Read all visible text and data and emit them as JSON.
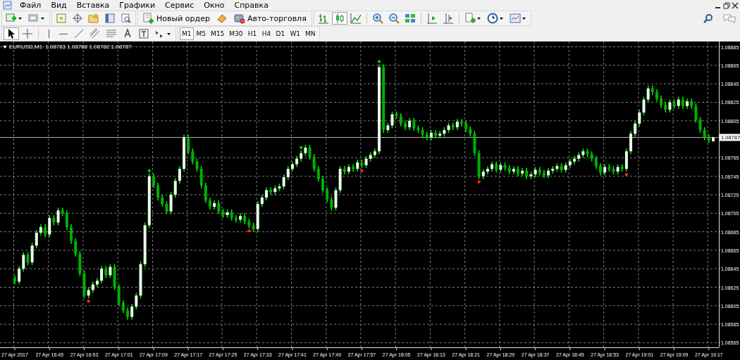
{
  "menu_bar": {
    "items": [
      "Файл",
      "Вид",
      "Вставка",
      "Графики",
      "Сервис",
      "Окно",
      "Справка"
    ]
  },
  "toolbar": {
    "new_order": "Новый ордер",
    "auto_trading": "Авто-торговля",
    "chart_types": [
      {
        "selected": false
      },
      {
        "selected": true
      },
      {
        "selected": false
      }
    ]
  },
  "drawing_toolbar": {
    "tools": [
      {
        "selected": true
      },
      {
        "selected": false
      },
      {
        "selected": false
      },
      {
        "selected": false
      },
      {
        "selected": false
      },
      {
        "selected": false
      },
      {
        "selected": false
      },
      {
        "selected": false
      },
      {
        "selected": false
      },
      {
        "selected": false
      }
    ],
    "timeframes": [
      {
        "label": "M1",
        "selected": true
      },
      {
        "label": "M5",
        "selected": false
      },
      {
        "label": "M15",
        "selected": false
      },
      {
        "label": "M30",
        "selected": false
      },
      {
        "label": "H1",
        "selected": false
      },
      {
        "label": "H4",
        "selected": false
      },
      {
        "label": "D1",
        "selected": false
      },
      {
        "label": "W1",
        "selected": false
      },
      {
        "label": "MN",
        "selected": false
      }
    ]
  },
  "chart": {
    "quote": "1.08783 1.08788 1.08782 1.08787",
    "signals": [
      {
        "kind": "below",
        "color": "#ff2020"
      },
      {
        "kind": "above",
        "color": "#00c000"
      },
      {
        "kind": "below",
        "color": "#ff2020"
      },
      {
        "kind": "above",
        "color": "#00c000"
      },
      {
        "kind": "below",
        "color": "#ff2020"
      },
      {
        "kind": "above",
        "color": "#00c000"
      },
      {
        "kind": "below",
        "color": "#ff2020"
      },
      {
        "kind": "below",
        "color": "#ff2020"
      }
    ],
    "chart_data": {
      "type": "candlestick",
      "title": "EURUSD,M1",
      "grid": true,
      "ylim": [
        1.0856,
        1.0889
      ],
      "yticks": [
        1.08885,
        1.08865,
        1.08845,
        1.08825,
        1.08805,
        1.08765,
        1.08745,
        1.08725,
        1.08705,
        1.08685,
        1.08665,
        1.08645,
        1.08625,
        1.08605,
        1.08585,
        1.08565
      ],
      "ref_lines": [
        {
          "axis": "y",
          "value": 1.08787,
          "label": "1.08787"
        }
      ],
      "categories": [
        "27 Apr 2017",
        null,
        null,
        null,
        null,
        null,
        null,
        null,
        "27 Apr 16:45",
        null,
        null,
        null,
        null,
        null,
        null,
        null,
        "27 Apr 16:53",
        null,
        null,
        null,
        null,
        null,
        null,
        null,
        "27 Apr 17:01",
        null,
        null,
        null,
        null,
        null,
        null,
        null,
        "27 Apr 17:09",
        null,
        null,
        null,
        null,
        null,
        null,
        null,
        "27 Apr 17:17",
        null,
        null,
        null,
        null,
        null,
        null,
        null,
        "27 Apr 17:25",
        null,
        null,
        null,
        null,
        null,
        null,
        null,
        "27 Apr 17:33",
        null,
        null,
        null,
        null,
        null,
        null,
        null,
        "27 Apr 17:41",
        null,
        null,
        null,
        null,
        null,
        null,
        null,
        "27 Apr 17:49",
        null,
        null,
        null,
        null,
        null,
        null,
        null,
        "27 Apr 17:57",
        null,
        null,
        null,
        null,
        null,
        null,
        null,
        "27 Apr 18:05",
        null,
        null,
        null,
        null,
        null,
        null,
        null,
        "27 Apr 18:13",
        null,
        null,
        null,
        null,
        null,
        null,
        null,
        "27 Apr 18:21",
        null,
        null,
        null,
        null,
        null,
        null,
        null,
        "27 Apr 18:29",
        null,
        null,
        null,
        null,
        null,
        null,
        null,
        "27 Apr 18:37",
        null,
        null,
        null,
        null,
        null,
        null,
        null,
        "27 Apr 18:45",
        null,
        null,
        null,
        null,
        null,
        null,
        null,
        "27 Apr 18:53",
        null,
        null,
        null,
        null,
        null,
        null,
        null,
        "27 Apr 19:01",
        null,
        null,
        null,
        null,
        null,
        null,
        null,
        "27 Apr 19:09",
        null,
        null,
        null,
        null,
        null,
        null,
        null,
        "27 Apr 19:17",
        null
      ],
      "ohlc": [
        [
          1.08635,
          1.08638,
          1.08628,
          1.08631
        ],
        [
          1.08631,
          1.08648,
          1.08628,
          1.08645
        ],
        [
          1.08645,
          1.08663,
          1.08642,
          1.0866
        ],
        [
          1.0866,
          1.08663,
          1.08649,
          1.08652
        ],
        [
          1.08652,
          1.08673,
          1.08649,
          1.0867
        ],
        [
          1.0867,
          1.08687,
          1.08667,
          1.08684
        ],
        [
          1.08684,
          1.08693,
          1.08681,
          1.0869
        ],
        [
          1.0869,
          1.08693,
          1.08679,
          1.08682
        ],
        [
          1.08682,
          1.08703,
          1.08679,
          1.087
        ],
        [
          1.087,
          1.08703,
          1.08692,
          1.08695
        ],
        [
          1.08695,
          1.08711,
          1.08692,
          1.08708
        ],
        [
          1.08708,
          1.08711,
          1.08702,
          1.08705
        ],
        [
          1.08705,
          1.08708,
          1.08687,
          1.0869
        ],
        [
          1.0869,
          1.08693,
          1.08672,
          1.08675
        ],
        [
          1.08675,
          1.08678,
          1.08658,
          1.08661
        ],
        [
          1.08661,
          1.08664,
          1.08637,
          1.0864
        ],
        [
          1.0864,
          1.08643,
          1.08613,
          1.08616
        ],
        [
          1.08616,
          1.08625,
          1.08613,
          1.08622
        ],
        [
          1.08622,
          1.08631,
          1.08619,
          1.08628
        ],
        [
          1.08628,
          1.08635,
          1.08625,
          1.08632
        ],
        [
          1.08632,
          1.08648,
          1.08629,
          1.08645
        ],
        [
          1.08645,
          1.08648,
          1.08635,
          1.08638
        ],
        [
          1.08638,
          1.0865,
          1.08635,
          1.08647
        ],
        [
          1.08647,
          1.0865,
          1.08622,
          1.08625
        ],
        [
          1.08625,
          1.08628,
          1.08605,
          1.08608
        ],
        [
          1.08608,
          1.08611,
          1.08597,
          1.086
        ],
        [
          1.086,
          1.08603,
          1.0859,
          1.08593
        ],
        [
          1.08593,
          1.08607,
          1.0859,
          1.08604
        ],
        [
          1.08604,
          1.08619,
          1.08601,
          1.08616
        ],
        [
          1.08616,
          1.08653,
          1.08613,
          1.0865
        ],
        [
          1.0865,
          1.08695,
          1.08647,
          1.08692
        ],
        [
          1.08692,
          1.08748,
          1.08689,
          1.08745
        ],
        [
          1.08745,
          1.08748,
          1.08732,
          1.08735
        ],
        [
          1.08735,
          1.08738,
          1.08719,
          1.08722
        ],
        [
          1.08722,
          1.08725,
          1.08712,
          1.08715
        ],
        [
          1.08715,
          1.08718,
          1.08704,
          1.08707
        ],
        [
          1.08707,
          1.08728,
          1.08704,
          1.08725
        ],
        [
          1.08725,
          1.08743,
          1.08722,
          1.0874
        ],
        [
          1.0874,
          1.08756,
          1.08737,
          1.08753
        ],
        [
          1.08753,
          1.0879,
          1.0875,
          1.08787
        ],
        [
          1.08787,
          1.0879,
          1.08769,
          1.08772
        ],
        [
          1.08772,
          1.08775,
          1.08758,
          1.08761
        ],
        [
          1.08761,
          1.08764,
          1.0875,
          1.08753
        ],
        [
          1.08753,
          1.08756,
          1.08732,
          1.08735
        ],
        [
          1.08735,
          1.08738,
          1.08716,
          1.08719
        ],
        [
          1.08719,
          1.08722,
          1.08709,
          1.08712
        ],
        [
          1.08712,
          1.08719,
          1.08709,
          1.08716
        ],
        [
          1.08716,
          1.08719,
          1.08704,
          1.08707
        ],
        [
          1.08707,
          1.0871,
          1.087,
          1.08703
        ],
        [
          1.08703,
          1.08709,
          1.087,
          1.08706
        ],
        [
          1.08706,
          1.08709,
          1.08697,
          1.087
        ],
        [
          1.087,
          1.08703,
          1.08695,
          1.08698
        ],
        [
          1.08698,
          1.08705,
          1.08695,
          1.08702
        ],
        [
          1.08702,
          1.08705,
          1.08693,
          1.08696
        ],
        [
          1.08696,
          1.08699,
          1.08689,
          1.08692
        ],
        [
          1.08692,
          1.08695,
          1.08685,
          1.08688
        ],
        [
          1.08688,
          1.08718,
          1.08685,
          1.08715
        ],
        [
          1.08715,
          1.08725,
          1.08712,
          1.08722
        ],
        [
          1.08722,
          1.08733,
          1.08719,
          1.0873
        ],
        [
          1.0873,
          1.08733,
          1.08725,
          1.08728
        ],
        [
          1.08728,
          1.08735,
          1.08725,
          1.08732
        ],
        [
          1.08732,
          1.08737,
          1.08729,
          1.08734
        ],
        [
          1.08734,
          1.08747,
          1.08731,
          1.08744
        ],
        [
          1.08744,
          1.08756,
          1.08741,
          1.08753
        ],
        [
          1.08753,
          1.08761,
          1.0875,
          1.08758
        ],
        [
          1.08758,
          1.08767,
          1.08755,
          1.08764
        ],
        [
          1.08764,
          1.08773,
          1.08761,
          1.0877
        ],
        [
          1.0877,
          1.08779,
          1.08767,
          1.08776
        ],
        [
          1.08776,
          1.08779,
          1.08763,
          1.08766
        ],
        [
          1.08766,
          1.08769,
          1.0875,
          1.08753
        ],
        [
          1.08753,
          1.08756,
          1.08739,
          1.08742
        ],
        [
          1.08742,
          1.08745,
          1.08727,
          1.0873
        ],
        [
          1.0873,
          1.08733,
          1.08717,
          1.0872
        ],
        [
          1.0872,
          1.08723,
          1.08708,
          1.08711
        ],
        [
          1.08711,
          1.08733,
          1.08708,
          1.0873
        ],
        [
          1.0873,
          1.08756,
          1.08727,
          1.08753
        ],
        [
          1.08753,
          1.08756,
          1.08747,
          1.0875
        ],
        [
          1.0875,
          1.08758,
          1.08747,
          1.08755
        ],
        [
          1.08755,
          1.08758,
          1.0875,
          1.08753
        ],
        [
          1.08753,
          1.08763,
          1.0875,
          1.0876
        ],
        [
          1.0876,
          1.08763,
          1.08754,
          1.08757
        ],
        [
          1.08757,
          1.08767,
          1.08754,
          1.08764
        ],
        [
          1.08764,
          1.08771,
          1.08761,
          1.08768
        ],
        [
          1.08768,
          1.08775,
          1.08765,
          1.08772
        ],
        [
          1.08772,
          1.08866,
          1.08769,
          1.08863
        ],
        [
          1.08863,
          1.08866,
          1.08792,
          1.08795
        ],
        [
          1.08795,
          1.08803,
          1.08792,
          1.088
        ],
        [
          1.088,
          1.08815,
          1.08797,
          1.08812
        ],
        [
          1.08812,
          1.08815,
          1.08807,
          1.0881
        ],
        [
          1.0881,
          1.08813,
          1.08799,
          1.08802
        ],
        [
          1.08802,
          1.08805,
          1.08795,
          1.08798
        ],
        [
          1.08798,
          1.08808,
          1.08795,
          1.08805
        ],
        [
          1.08805,
          1.08808,
          1.08794,
          1.08797
        ],
        [
          1.08797,
          1.088,
          1.08792,
          1.08795
        ],
        [
          1.08795,
          1.08798,
          1.08787,
          1.0879
        ],
        [
          1.0879,
          1.08793,
          1.08784,
          1.08787
        ],
        [
          1.08787,
          1.08795,
          1.08784,
          1.08792
        ],
        [
          1.08792,
          1.08795,
          1.08786,
          1.08789
        ],
        [
          1.08789,
          1.08794,
          1.08786,
          1.08791
        ],
        [
          1.08791,
          1.08798,
          1.08788,
          1.08795
        ],
        [
          1.08795,
          1.08803,
          1.08792,
          1.088
        ],
        [
          1.088,
          1.08803,
          1.08795,
          1.08798
        ],
        [
          1.08798,
          1.08807,
          1.08795,
          1.08804
        ],
        [
          1.08804,
          1.08807,
          1.08799,
          1.08802
        ],
        [
          1.08802,
          1.08805,
          1.08793,
          1.08796
        ],
        [
          1.08796,
          1.08799,
          1.08788,
          1.08791
        ],
        [
          1.08791,
          1.08794,
          1.08767,
          1.0877
        ],
        [
          1.0877,
          1.08773,
          1.08742,
          1.08745
        ],
        [
          1.08745,
          1.08753,
          1.08742,
          1.0875
        ],
        [
          1.0875,
          1.08756,
          1.08747,
          1.08753
        ],
        [
          1.08753,
          1.08761,
          1.0875,
          1.08758
        ],
        [
          1.08758,
          1.08761,
          1.08749,
          1.08752
        ],
        [
          1.08752,
          1.0876,
          1.08749,
          1.08757
        ],
        [
          1.08757,
          1.0876,
          1.08751,
          1.08754
        ],
        [
          1.08754,
          1.08757,
          1.08747,
          1.0875
        ],
        [
          1.0875,
          1.08756,
          1.08747,
          1.08753
        ],
        [
          1.08753,
          1.08756,
          1.08745,
          1.08748
        ],
        [
          1.08748,
          1.08754,
          1.08745,
          1.08751
        ],
        [
          1.08751,
          1.08754,
          1.08742,
          1.08745
        ],
        [
          1.08745,
          1.0875,
          1.08742,
          1.08747
        ],
        [
          1.08747,
          1.08755,
          1.08744,
          1.08752
        ],
        [
          1.08752,
          1.08755,
          1.08746,
          1.08749
        ],
        [
          1.08749,
          1.08752,
          1.08743,
          1.08746
        ],
        [
          1.08746,
          1.08754,
          1.08743,
          1.08751
        ],
        [
          1.08751,
          1.08756,
          1.08748,
          1.08753
        ],
        [
          1.08753,
          1.08759,
          1.0875,
          1.08756
        ],
        [
          1.08756,
          1.08759,
          1.08749,
          1.08752
        ],
        [
          1.08752,
          1.0876,
          1.08749,
          1.08757
        ],
        [
          1.08757,
          1.08764,
          1.08754,
          1.08761
        ],
        [
          1.08761,
          1.08767,
          1.08758,
          1.08764
        ],
        [
          1.08764,
          1.08771,
          1.08761,
          1.08768
        ],
        [
          1.08768,
          1.08775,
          1.08765,
          1.08772
        ],
        [
          1.08772,
          1.08775,
          1.08766,
          1.08769
        ],
        [
          1.08769,
          1.08772,
          1.08761,
          1.08764
        ],
        [
          1.08764,
          1.08767,
          1.08753,
          1.08756
        ],
        [
          1.08756,
          1.08759,
          1.08746,
          1.08749
        ],
        [
          1.08749,
          1.08758,
          1.08746,
          1.08755
        ],
        [
          1.08755,
          1.08758,
          1.0875,
          1.08753
        ],
        [
          1.08753,
          1.08756,
          1.08747,
          1.0875
        ],
        [
          1.0875,
          1.08758,
          1.08747,
          1.08755
        ],
        [
          1.08755,
          1.08758,
          1.0875,
          1.08753
        ],
        [
          1.08753,
          1.08775,
          1.0875,
          1.08772
        ],
        [
          1.08772,
          1.08794,
          1.08769,
          1.08791
        ],
        [
          1.08791,
          1.08805,
          1.08788,
          1.08802
        ],
        [
          1.08802,
          1.08817,
          1.08799,
          1.08814
        ],
        [
          1.08814,
          1.08831,
          1.08811,
          1.08828
        ],
        [
          1.08828,
          1.08843,
          1.08825,
          1.0884
        ],
        [
          1.0884,
          1.08843,
          1.08833,
          1.08836
        ],
        [
          1.08836,
          1.08839,
          1.08826,
          1.08829
        ],
        [
          1.08829,
          1.08832,
          1.08819,
          1.08822
        ],
        [
          1.08822,
          1.08825,
          1.08814,
          1.08817
        ],
        [
          1.08817,
          1.08828,
          1.08814,
          1.08825
        ],
        [
          1.08825,
          1.08828,
          1.08818,
          1.08821
        ],
        [
          1.08821,
          1.08831,
          1.08818,
          1.08828
        ],
        [
          1.08828,
          1.08831,
          1.08818,
          1.08821
        ],
        [
          1.08821,
          1.08829,
          1.08818,
          1.08826
        ],
        [
          1.08826,
          1.08829,
          1.08818,
          1.08821
        ],
        [
          1.08821,
          1.08824,
          1.08803,
          1.08806
        ],
        [
          1.08806,
          1.08809,
          1.08792,
          1.08795
        ],
        [
          1.08795,
          1.08798,
          1.08784,
          1.08787
        ],
        [
          1.08787,
          1.0879,
          1.08781,
          1.08784
        ],
        [
          1.08783,
          1.08788,
          1.08782,
          1.08787
        ]
      ]
    }
  }
}
